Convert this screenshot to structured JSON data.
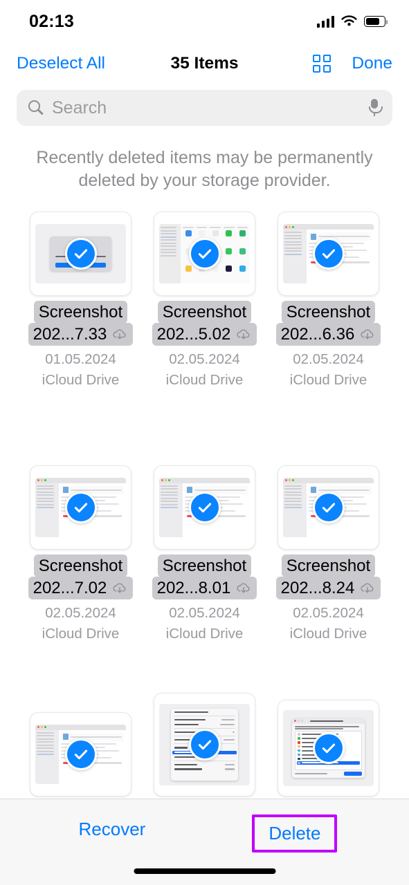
{
  "status_bar": {
    "time": "02:13",
    "signal_icon": "cellular-bars-icon",
    "wifi_icon": "wifi-icon",
    "battery_icon": "battery-icon",
    "battery_level": 75
  },
  "nav_bar": {
    "deselect_all_label": "Deselect All",
    "title": "35 Items",
    "grid_view_icon": "grid-view-icon",
    "done_label": "Done"
  },
  "search": {
    "placeholder": "Search",
    "value": "",
    "search_icon": "search-icon",
    "mic_icon": "microphone-icon"
  },
  "notice": "Recently deleted items may be permanently deleted by your storage provider.",
  "colors": {
    "accent": "#007AFF",
    "check_badge": "#0A84FF",
    "highlight_box": "#BF00FF",
    "name_highlight": "#C9C9CE",
    "secondary_text": "#8E8E93"
  },
  "files": [
    {
      "name_line1": "Screenshot",
      "name_line2": "202...7.33",
      "date": "01.05.2024",
      "source": "iCloud Drive",
      "selected": true,
      "cloud_icon": "icloud-download-icon",
      "thumb": "disk-drill-alert"
    },
    {
      "name_line1": "Screenshot",
      "name_line2": "202...5.02",
      "date": "02.05.2024",
      "source": "iCloud Drive",
      "selected": true,
      "cloud_icon": "icloud-download-icon",
      "thumb": "launchpad-apps"
    },
    {
      "name_line1": "Screenshot",
      "name_line2": "202...6.36",
      "date": "02.05.2024",
      "source": "iCloud Drive",
      "selected": true,
      "cloud_icon": "icloud-download-icon",
      "thumb": "finder-window"
    },
    {
      "name_line1": "Screenshot",
      "name_line2": "202...7.02",
      "date": "02.05.2024",
      "source": "iCloud Drive",
      "selected": true,
      "cloud_icon": "icloud-download-icon",
      "thumb": "finder-window"
    },
    {
      "name_line1": "Screenshot",
      "name_line2": "202...8.01",
      "date": "02.05.2024",
      "source": "iCloud Drive",
      "selected": true,
      "cloud_icon": "icloud-download-icon",
      "thumb": "finder-window"
    },
    {
      "name_line1": "Screenshot",
      "name_line2": "202...8.24",
      "date": "02.05.2024",
      "source": "iCloud Drive",
      "selected": true,
      "cloud_icon": "icloud-download-icon",
      "thumb": "finder-window"
    }
  ],
  "partial_row": [
    {
      "thumb": "finder-window",
      "selected": true
    },
    {
      "thumb": "apple-menu",
      "selected": true
    },
    {
      "thumb": "force-quit",
      "selected": true
    }
  ],
  "apple_menu_thumb": {
    "items": [
      "About This Mac",
      "System Settings...",
      "App Store...",
      "Recent Items",
      "Force Quit Telegram",
      "Sleep",
      "Restart...",
      "Shut Down",
      "Lock Screen",
      "Log Out Ma..."
    ],
    "badges": [
      "1 update",
      "2 updates"
    ],
    "selected_item": "Restart..."
  },
  "force_quit_thumb": {
    "title": "Force Quit Applications",
    "note": "If an app doesn't respond for a while, select its name and click Relaunch.",
    "apps": [
      "Messages",
      "Music",
      "Notes",
      "Safari",
      "Telegram",
      "TV",
      "Finder"
    ],
    "selected_app": "Finder",
    "button_label": "Relaunch"
  },
  "toolbar": {
    "recover_label": "Recover",
    "delete_label": "Delete",
    "delete_highlighted": true
  }
}
